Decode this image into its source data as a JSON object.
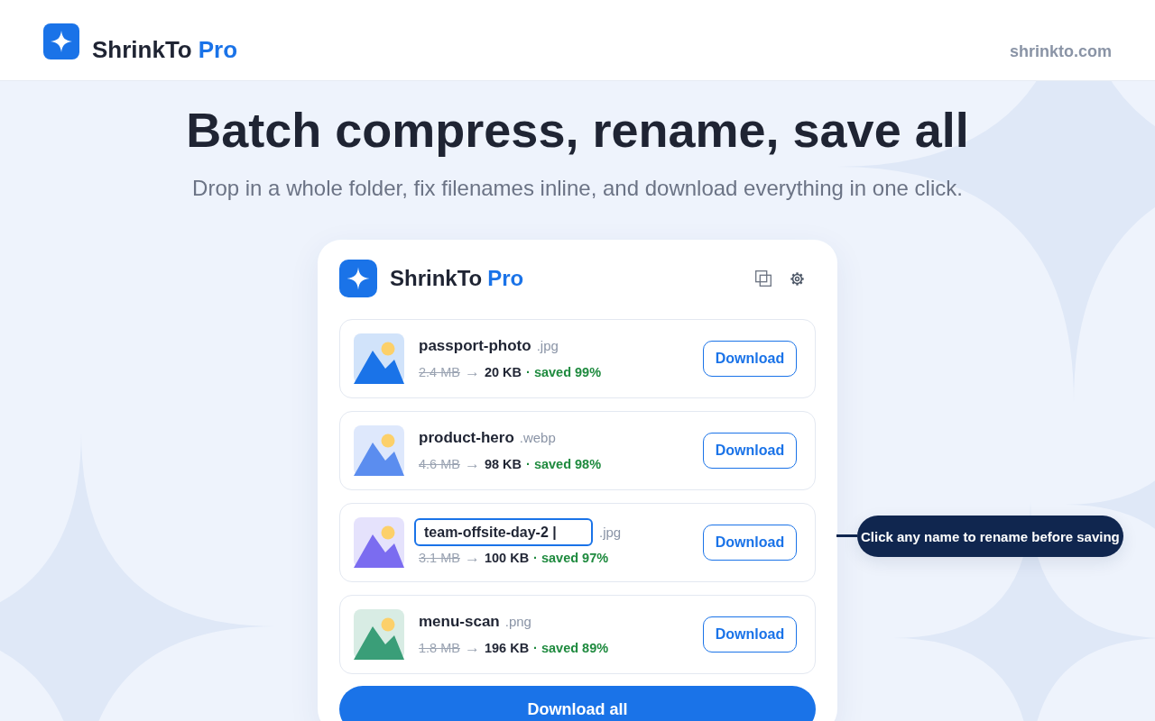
{
  "header": {
    "brand": {
      "name": "ShrinkTo",
      "tier": "Pro"
    },
    "site_link": "shrinkto.com"
  },
  "hero": {
    "title": "Batch compress, rename, save all",
    "subtitle": "Drop in a whole folder, fix filenames inline, and download everything in one click."
  },
  "card": {
    "brand": {
      "name": "ShrinkTo",
      "tier": "Pro"
    },
    "files": [
      {
        "name": "passport-photo",
        "ext": ".jpg",
        "editing": false,
        "color": "#1a73e8",
        "size_from": "2.4 MB",
        "arrow": "→",
        "size_to": "20 KB",
        "savings": "· saved 99%",
        "action": "Download"
      },
      {
        "name": "product-hero",
        "ext": ".webp",
        "editing": false,
        "color": "#5b8def",
        "size_from": "4.6 MB",
        "arrow": "→",
        "size_to": "98 KB",
        "savings": "· saved 98%",
        "action": "Download"
      },
      {
        "name": "team-offsite-day-2 |",
        "ext": ".jpg",
        "editing": true,
        "color": "#7b6cf0",
        "size_from": "3.1 MB",
        "arrow": "→",
        "size_to": "100 KB",
        "savings": "· saved 97%",
        "action": "Download",
        "callout": "Click any name to rename before saving"
      },
      {
        "name": "menu-scan",
        "ext": ".png",
        "editing": false,
        "color": "#3a9e78",
        "size_from": "1.8 MB",
        "arrow": "→",
        "size_to": "196 KB",
        "savings": "· saved 89%",
        "action": "Download"
      }
    ],
    "primary_button": "Download all"
  }
}
